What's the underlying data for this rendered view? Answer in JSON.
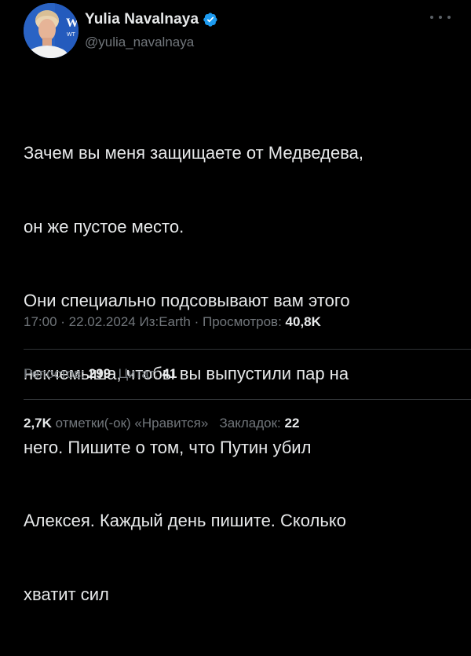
{
  "author": {
    "display_name": "Yulia Navalnaya",
    "handle": "@yulia_navalnaya",
    "verified": true,
    "avatar_icon": "profile-photo",
    "avatar_letters": "W"
  },
  "tweet": {
    "lines": [
      "Зачем вы меня защищаете от Медведева,",
      "он же пустое место.",
      "Они специально подсовывают вам этого",
      "некчемыша, чтобы вы выпустили пар на",
      "него. Пишите о том, что Путин убил",
      "Алексея. Каждый день пишите. Сколько",
      "хватит сил"
    ]
  },
  "meta": {
    "time": "17:00",
    "sep1": " · ",
    "date": "22.02.2024",
    "source_prefix": " Из:",
    "source": "Earth",
    "sep2": " · ",
    "views_label": "Просмотров: ",
    "views_count": "40,8K"
  },
  "stats": {
    "reposts_label": "Репостов: ",
    "reposts_count": "299",
    "quotes_label": "Цитат: ",
    "quotes_count": "41",
    "likes_count": "2,7K",
    "likes_label": " отметки(-ок) «Нравится»",
    "bookmarks_label": "Закладок: ",
    "bookmarks_count": "22"
  },
  "colors": {
    "background": "#000000",
    "text_primary": "#e7e9ea",
    "text_secondary": "#71767b",
    "verified_blue": "#1d9bf0",
    "divider": "#2f3336"
  }
}
